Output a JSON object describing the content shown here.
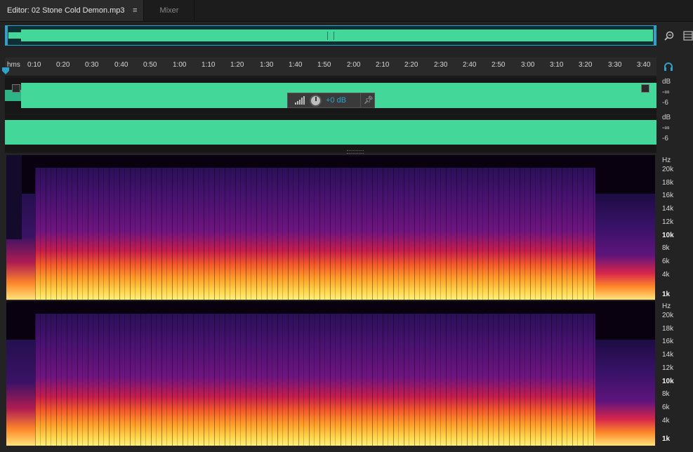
{
  "tabs": {
    "editor_label": "Editor: 02 Stone Cold Demon.mp3",
    "editor_menu_icon": "hamburger-icon",
    "mixer_label": "Mixer"
  },
  "ruler": {
    "unit": "hms",
    "ticks": [
      "0:10",
      "0:20",
      "0:30",
      "0:40",
      "0:50",
      "1:00",
      "1:10",
      "1:20",
      "1:30",
      "1:40",
      "1:50",
      "2:00",
      "2:10",
      "2:20",
      "2:30",
      "2:40",
      "2:50",
      "3:00",
      "3:10",
      "3:20",
      "3:30",
      "3:40"
    ]
  },
  "hud": {
    "gain_value": "+0 dB",
    "icons": [
      "level-bars-icon",
      "volume-knob-icon",
      "pin-icon"
    ]
  },
  "db_scale": {
    "ch1": [
      "dB",
      "-∞",
      "-6"
    ],
    "ch2": [
      "dB",
      "-∞",
      "-6"
    ]
  },
  "hz_scale": {
    "ch1": [
      "Hz",
      "20k",
      "18k",
      "16k",
      "14k",
      "12k",
      "10k",
      "8k",
      "6k",
      "4k",
      "1k"
    ],
    "ch2": [
      "Hz",
      "20k",
      "18k",
      "16k",
      "14k",
      "12k",
      "10k",
      "8k",
      "6k",
      "4k",
      "1k"
    ]
  },
  "colors": {
    "waveform": "#43d79a",
    "accent": "#2ea2c8"
  }
}
